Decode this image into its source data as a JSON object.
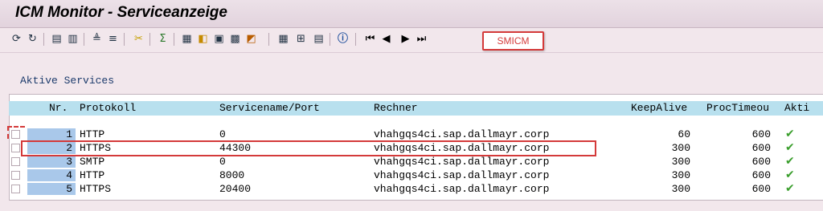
{
  "window": {
    "title": "ICM Monitor - Serviceanzeige"
  },
  "toolbar": {
    "buttons": [
      "refresh-icon",
      "reload-icon",
      "details-icon",
      "print-icon",
      "align-icon",
      "filter-icon",
      "cut-icon",
      "sum-icon",
      "export-icon",
      "layout-icon",
      "select-layout-icon",
      "save-layout-icon",
      "graphic-icon",
      "grid-icon",
      "columns-icon",
      "settings-icon",
      "info-icon",
      "first-page-icon",
      "previous-page-icon",
      "next-page-icon",
      "last-page-icon"
    ],
    "callout": "SMICM"
  },
  "section": {
    "title": "Aktive Services"
  },
  "table": {
    "headers": {
      "nr": "Nr.",
      "protokoll": "Protokoll",
      "service": "Servicename/Port",
      "rechner": "Rechner",
      "keepalive": "KeepAlive",
      "proctimeout": "ProcTimeou",
      "aktiv": "Akti"
    },
    "rows": [
      {
        "nr": "1",
        "protokoll": "HTTP",
        "service": "0",
        "rechner": "vhahgqs4ci.sap.dallmayr.corp",
        "keepalive": "60",
        "proctimeout": "600"
      },
      {
        "nr": "2",
        "protokoll": "HTTPS",
        "service": "44300",
        "rechner": "vhahgqs4ci.sap.dallmayr.corp",
        "keepalive": "300",
        "proctimeout": "600"
      },
      {
        "nr": "3",
        "protokoll": "SMTP",
        "service": "0",
        "rechner": "vhahgqs4ci.sap.dallmayr.corp",
        "keepalive": "300",
        "proctimeout": "600"
      },
      {
        "nr": "4",
        "protokoll": "HTTP",
        "service": "8000",
        "rechner": "vhahgqs4ci.sap.dallmayr.corp",
        "keepalive": "300",
        "proctimeout": "600"
      },
      {
        "nr": "5",
        "protokoll": "HTTPS",
        "service": "20400",
        "rechner": "vhahgqs4ci.sap.dallmayr.corp",
        "keepalive": "300",
        "proctimeout": "600"
      }
    ],
    "active_icon": "checkmark-icon",
    "active_color": "#3a9e2c"
  },
  "colors": {
    "header_bg": "#b8e0ee",
    "row_number_bg": "#a9c8ea",
    "annotation": "#d43a3a"
  }
}
